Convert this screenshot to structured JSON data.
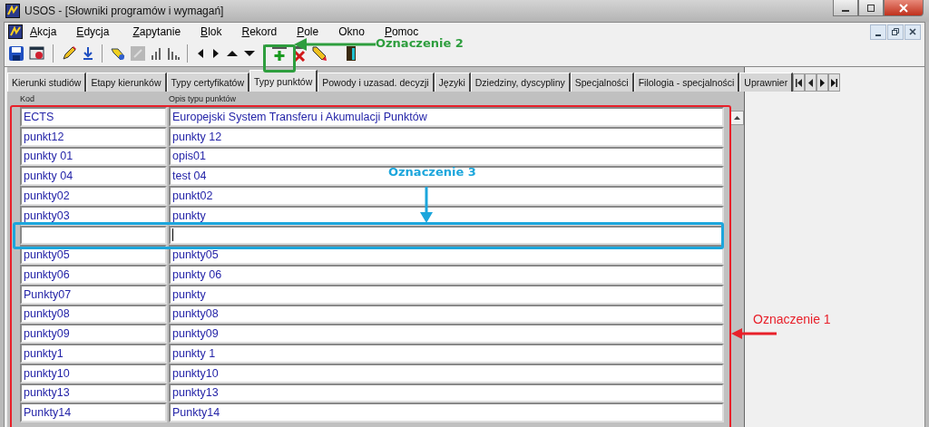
{
  "window": {
    "title": "USOS - [Słowniki programów i wymagań]"
  },
  "menu": [
    {
      "label": "Akcja",
      "mnemonic": true
    },
    {
      "label": "Edycja",
      "mnemonic": true
    },
    {
      "label": "Zapytanie",
      "mnemonic": true
    },
    {
      "label": "Blok",
      "mnemonic": true
    },
    {
      "label": "Rekord",
      "mnemonic": true
    },
    {
      "label": "Pole",
      "mnemonic": true
    },
    {
      "label": "Okno",
      "mnemonic": false
    },
    {
      "label": "Pomoc",
      "mnemonic": true
    }
  ],
  "tabs": [
    {
      "label": "Kierunki studiów",
      "selected": false
    },
    {
      "label": "Etapy kierunków",
      "selected": false
    },
    {
      "label": "Typy certyfikatów",
      "selected": false
    },
    {
      "label": "Typy punktów",
      "selected": true
    },
    {
      "label": "Powody i uzasad. decyzji",
      "selected": false
    },
    {
      "label": "Języki",
      "selected": false
    },
    {
      "label": "Dziedziny, dyscypliny",
      "selected": false
    },
    {
      "label": "Specjalności",
      "selected": false
    },
    {
      "label": "Filologia - specjalności",
      "selected": false
    },
    {
      "label": "Uprawnier",
      "selected": false
    }
  ],
  "table": {
    "columns": [
      "Kod",
      "Opis typu punktów"
    ],
    "rows": [
      {
        "kod": "ECTS",
        "opis": "Europejski System Transferu i Akumulacji Punktów",
        "current": false
      },
      {
        "kod": "punkt12",
        "opis": "punkty 12",
        "current": false
      },
      {
        "kod": "punkty 01",
        "opis": "opis01",
        "current": false
      },
      {
        "kod": "punkty 04",
        "opis": "test 04",
        "current": false
      },
      {
        "kod": "punkty02",
        "opis": "punkt02",
        "current": false
      },
      {
        "kod": "punkty03",
        "opis": "punkty",
        "current": false
      },
      {
        "current": true
      },
      {
        "kod": "punkty05",
        "opis": "punkty05",
        "current": false
      },
      {
        "kod": "punkty06",
        "opis": "punkty 06",
        "current": false
      },
      {
        "kod": "Punkty07",
        "opis": "punkty",
        "current": false
      },
      {
        "kod": "punkty08",
        "opis": "punkty08",
        "current": false
      },
      {
        "kod": "punkty09",
        "opis": "punkty09",
        "current": false
      },
      {
        "kod": "punkty1",
        "opis": "punkty 1",
        "current": false
      },
      {
        "kod": "punkty10",
        "opis": "punkty10",
        "current": false
      },
      {
        "kod": "punkty13",
        "opis": "punkty13",
        "current": false
      },
      {
        "kod": "Punkty14",
        "opis": "Punkty14",
        "current": false
      }
    ]
  },
  "annotations": [
    {
      "label": "Oznaczenie 1",
      "color": "#e8202a"
    },
    {
      "label": "Oznaczenie 2",
      "color": "#2e9e3e"
    },
    {
      "label": "Oznaczenie 3",
      "color": "#1ca6dc"
    }
  ]
}
